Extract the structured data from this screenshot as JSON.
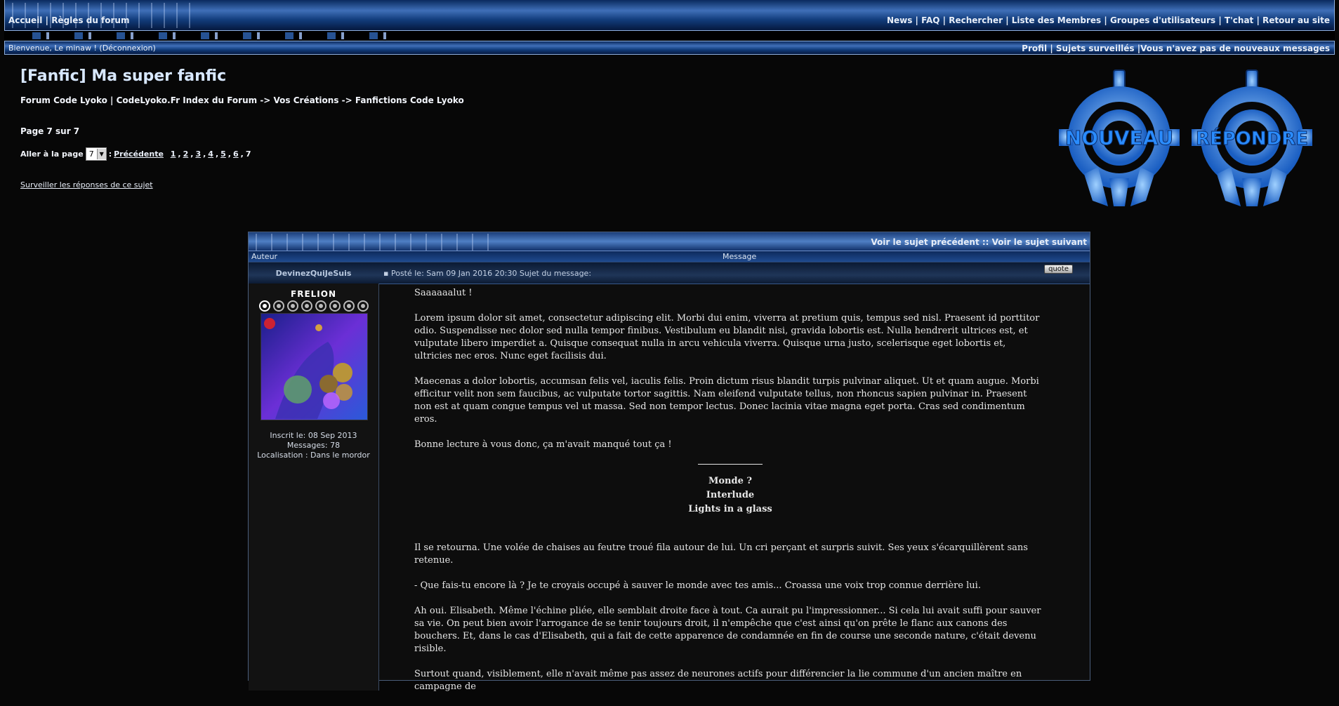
{
  "nav": {
    "left": [
      "Accueil",
      "Règles du forum"
    ],
    "right": [
      "News",
      "FAQ",
      "Rechercher",
      "Liste des Membres",
      "Groupes d'utilisateurs",
      "T'chat",
      "Retour au site"
    ]
  },
  "userbar": {
    "welcome": "Bienvenue, Le minaw ! (Déconnexion)",
    "profile": "Profil",
    "watched": "Sujets surveillés",
    "messages": "Vous n'avez pas de nouveaux messages"
  },
  "topic": {
    "title": "[Fanfic] Ma super fanfic",
    "breadcrumb": "Forum Code Lyoko | CodeLyoko.Fr Index du Forum -> Vos Créations -> Fanfictions Code Lyoko",
    "page_info": "Page 7 sur 7",
    "jump_label": "Aller à la page",
    "jump_value": "7",
    "prev": "Précédente",
    "pages": [
      "1",
      "2",
      "3",
      "4",
      "5",
      "6"
    ],
    "current_page": "7",
    "watch": "Surveiller les réponses de ce sujet",
    "new_button": "NOUVEAU",
    "reply_button": "RÉPONDRE"
  },
  "post": {
    "topic_nav": "Voir le sujet précédent :: Voir le sujet suivant",
    "col_author": "Auteur",
    "col_message": "Message",
    "author": "DevinezQuiJeSuis",
    "meta": "Posté le: Sam 09 Jan 2016 20:30    Sujet du message:",
    "quote": "quote",
    "rank": "FRELION",
    "registered": "Inscrit le: 08 Sep 2013",
    "messages": "Messages: 78",
    "location": "Localisation : Dans le mordor",
    "body": {
      "greeting": "Saaaaaalut !",
      "p1": "Lorem ipsum dolor sit amet, consectetur adipiscing elit. Morbi dui enim, viverra at pretium quis, tempus sed nisl. Praesent id porttitor odio. Suspendisse nec dolor sed nulla tempor finibus. Vestibulum eu blandit nisi, gravida lobortis est. Nulla hendrerit ultrices est, et vulputate libero imperdiet a. Quisque consequat nulla in arcu vehicula viverra. Quisque urna justo, scelerisque eget lobortis et, ultricies nec eros. Nunc eget facilisis dui.",
      "p2": "Maecenas a dolor lobortis, accumsan felis vel, iaculis felis. Proin dictum risus blandit turpis pulvinar aliquet. Ut et quam augue. Morbi efficitur velit non sem faucibus, ac vulputate tortor sagittis. Nam eleifend vulputate tellus, non rhoncus sapien pulvinar in. Praesent non est at quam congue tempus vel ut massa. Sed non tempor lectus. Donec lacinia vitae magna eget porta. Cras sed condimentum eros.",
      "p3": "Bonne lecture à vous donc, ça m'avait manqué tout ça !",
      "center1": "Monde ?",
      "center2": "Interlude",
      "center3": "Lights in a glass",
      "p4": "Il se retourna. Une volée de chaises au feutre troué fila autour de lui. Un cri perçant et surpris suivit. Ses yeux s'écarquillèrent sans retenue.",
      "p5": "- Que fais-tu encore là ? Je te croyais occupé à sauver le monde avec tes amis... Croassa une voix trop connue derrière lui.",
      "p6": "Ah oui. Elisabeth. Même l'échine pliée, elle semblait droite face à tout. Ca aurait pu l'impressionner... Si cela lui avait suffi pour sauver sa vie. On peut bien avoir l'arrogance de se tenir toujours droit, il n'empêche que c'est ainsi qu'on prête le flanc aux canons des bouchers. Et, dans le cas d'Elisabeth, qui a fait de cette apparence de condamnée en fin de course une seconde nature, c'était devenu risible.",
      "p7": "Surtout quand, visiblement, elle n'avait même pas assez de neurones actifs pour différencier la lie commune d'un ancien maître en campagne de"
    }
  },
  "colors": {
    "accent": "#3f6fb8",
    "background": "#070707",
    "logo_blue": "#2f7fe0"
  }
}
